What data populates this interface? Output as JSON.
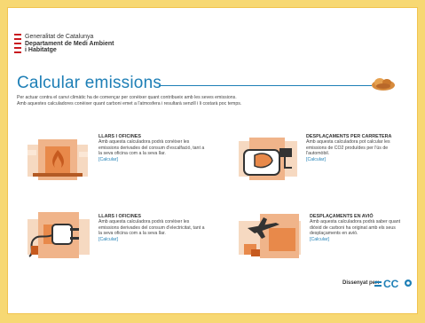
{
  "header": {
    "org_line1": "Generalitat de Catalunya",
    "org_line2": "Departament de Medi Ambient",
    "org_line3": "i Habitatge"
  },
  "page_title": "Calcular emissions",
  "intro": {
    "line1": "Per actuar contra el canvi climàtic ha de començar per conèixer quant contribueix amb les seves emissions.",
    "line2": "Amb aquestes calculadores conèixer quant carboni emet a l'atmosfera i resultarà senzill i li costarà poc temps."
  },
  "cards": [
    {
      "title": "LLARS I OFICINES",
      "desc": "Amb aquesta calculadora podrà conèixer les emissions derivades del consum d'escalfació, tant a la seva oficina com a la seva llar.",
      "link": "[Calcular]",
      "icon": "flame-icon"
    },
    {
      "title": "DESPLAÇAMENTS PER CARRETERA",
      "desc": "Amb aquesta calculadora pot calcular les emissions de CO2 produïdes per l'ús de l'automòbil.",
      "link": "[Calcular]",
      "icon": "fuel-pump-icon"
    },
    {
      "title": "LLARS I OFICINES",
      "desc": "Amb aquesta calculadora podrà conèixer les emissions derivades del consum d'electricitat, tant a la seva oficina com a la seva llar.",
      "link": "[Calcular]",
      "icon": "plug-icon"
    },
    {
      "title": "DESPLAÇAMENTS EN AVIÓ",
      "desc": "Amb aquesta calculadora podrà saber quant diòxid de carboni ha originat amb els seus desplaçaments en avió.",
      "link": "[Calcular]",
      "icon": "airplane-icon"
    }
  ],
  "footer": {
    "designed_by": "Dissenyat per:",
    "designer_logo_text": "CC"
  },
  "colors": {
    "accent": "#1e7fb6",
    "frame": "#f7d873",
    "illustration": "#e8894a"
  }
}
